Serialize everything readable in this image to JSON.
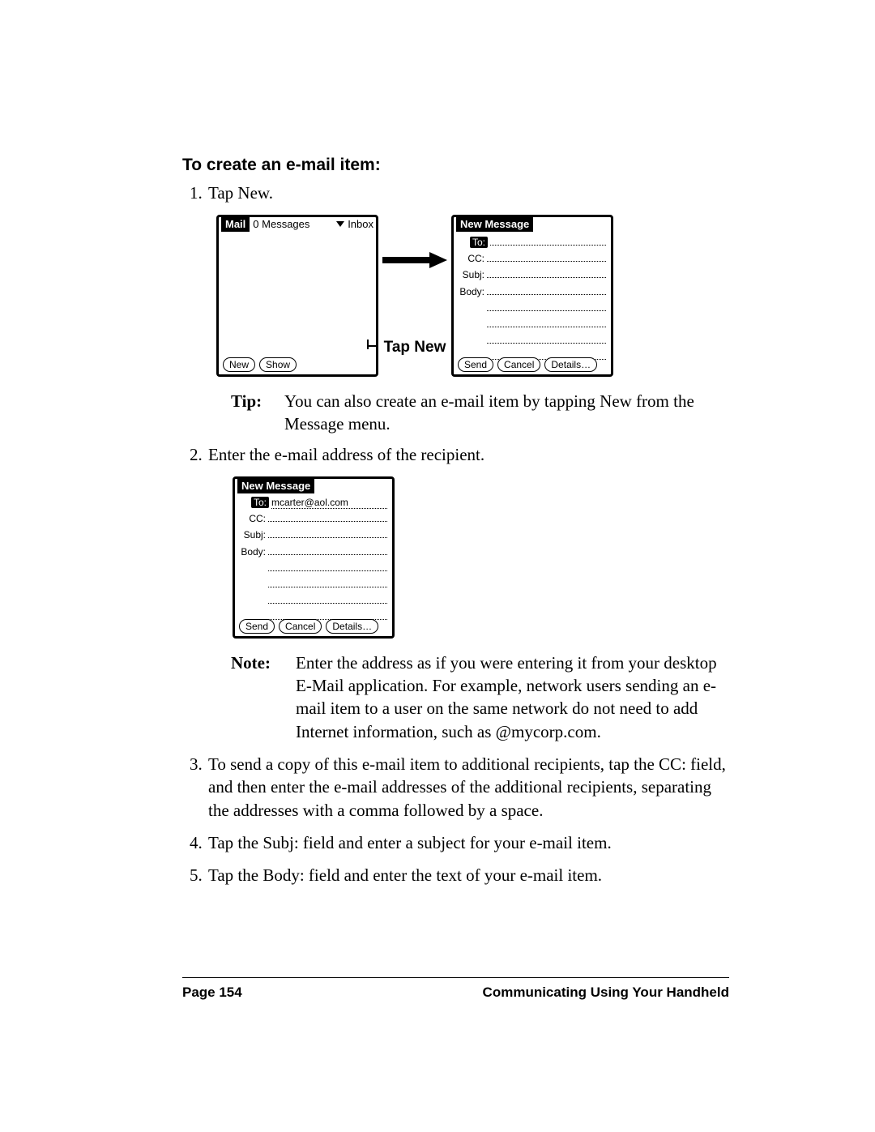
{
  "heading": "To create an e-mail item:",
  "steps": {
    "s1": "Tap New.",
    "s2": "Enter the e-mail address of the recipient.",
    "s3": "To send a copy of this e-mail item to additional recipients, tap the CC: field, and then enter the e-mail addresses of the additional recipients, separating the addresses with a comma followed by a space.",
    "s4": "Tap the Subj: field and enter a subject for your e-mail item.",
    "s5": "Tap the Body: field and enter the text of your e-mail item."
  },
  "tap_new_label": "Tap New",
  "tip": {
    "lead": "Tip:",
    "body": "You can also create an e-mail item by tapping New from the Message menu."
  },
  "note": {
    "lead": "Note:",
    "body": "Enter the address as if you were entering it from your desktop E-Mail application. For example, network users sending an e-mail item to a user on the same network do not need to add Internet information, such as @mycorp.com."
  },
  "screen_mail": {
    "title": "Mail",
    "count": "0 Messages",
    "folder": "Inbox",
    "buttons": {
      "new": "New",
      "show": "Show"
    }
  },
  "screen_new": {
    "title": "New Message",
    "labels": {
      "to": "To:",
      "cc": "CC:",
      "subj": "Subj:",
      "body": "Body:"
    },
    "values": {
      "to": "",
      "cc": "",
      "subj": "",
      "body": ""
    },
    "buttons": {
      "send": "Send",
      "cancel": "Cancel",
      "details": "Details…"
    }
  },
  "screen_new2": {
    "title": "New Message",
    "labels": {
      "to": "To:",
      "cc": "CC:",
      "subj": "Subj:",
      "body": "Body:"
    },
    "values": {
      "to": "mcarter@aol.com",
      "cc": "",
      "subj": "",
      "body": ""
    },
    "buttons": {
      "send": "Send",
      "cancel": "Cancel",
      "details": "Details…"
    }
  },
  "footer": {
    "page": "Page 154",
    "section": "Communicating Using Your Handheld"
  }
}
